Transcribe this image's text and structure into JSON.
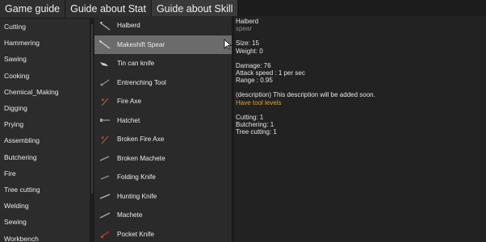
{
  "tabs": [
    "Game guide",
    "Guide about Stat",
    "Guide about Skill"
  ],
  "skills": [
    "Cutting",
    "Hammering",
    "Sawing",
    "Cooking",
    "Chemical_Making",
    "Digging",
    "Prying",
    "Assembling",
    "Butchering",
    "Fire",
    "Tree cutting",
    "Welding",
    "Sewing",
    "Workbench"
  ],
  "items": [
    {
      "label": "Halberd",
      "icon": "halberd-icon",
      "color": "#b0b0b0"
    },
    {
      "label": "Makeshift Spear",
      "icon": "spear-icon",
      "color": "#d0d0d0"
    },
    {
      "label": "Tin can knife",
      "icon": "tin-can-knife-icon",
      "color": "#cfcfcf"
    },
    {
      "label": "Entrenching Tool",
      "icon": "shovel-icon",
      "color": "#909090"
    },
    {
      "label": "Fire Axe",
      "icon": "fire-axe-icon",
      "color": "#c0392b"
    },
    {
      "label": "Hatchet",
      "icon": "hatchet-icon",
      "color": "#a0a0a0"
    },
    {
      "label": "Broken Fire Axe",
      "icon": "broken-axe-icon",
      "color": "#b04030"
    },
    {
      "label": "Broken Machete",
      "icon": "broken-machete-icon",
      "color": "#a0a0a0"
    },
    {
      "label": "Folding Knife",
      "icon": "folding-knife-icon",
      "color": "#a8a8a8"
    },
    {
      "label": "Hunting Knife",
      "icon": "hunting-knife-icon",
      "color": "#b8b8b8"
    },
    {
      "label": "Machete",
      "icon": "machete-icon",
      "color": "#a8a8a8"
    },
    {
      "label": "Pocket Knife",
      "icon": "pocket-knife-icon",
      "color": "#c03a2b"
    }
  ],
  "selected_index": 1,
  "detail": {
    "name": "Halberd",
    "type": "spear",
    "size": "Size: 15",
    "weight": "Weight: 0",
    "damage": "Damage: 76",
    "attack_speed": "Attack speed : 1 per sec",
    "range": "Range : 0.95",
    "description": "(description) This description will be added soon.",
    "tool_levels_title": "Have tool levels",
    "levels": [
      "Cutting: 1",
      "Butchering: 1",
      "Tree cutting: 1"
    ]
  },
  "colors": {
    "accent": "#e8a020",
    "selected": "#6b6b6b"
  }
}
